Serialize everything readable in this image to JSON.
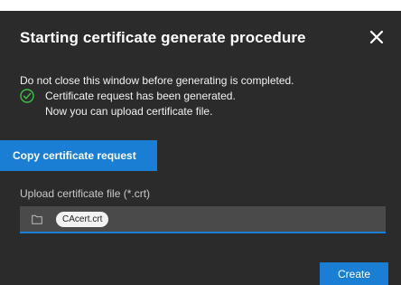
{
  "dialog": {
    "title": "Starting certificate generate procedure",
    "close_icon": "close-icon",
    "warning_text": "Do not close this window before generating is completed.",
    "status": {
      "icon": "check-circle-icon",
      "line1": "Certificate request has been generated.",
      "line2": "Now you can upload certificate file."
    },
    "copy_button_label": "Copy certificate request",
    "upload": {
      "label": "Upload certificate file (*.crt)",
      "folder_icon": "folder-icon",
      "file_name": "CAcert.crt"
    },
    "create_button_label": "Create"
  },
  "colors": {
    "background": "#2b2b2b",
    "accent": "#1a7fd4",
    "success": "#3fbf4a",
    "field": "#4a4a4a"
  }
}
